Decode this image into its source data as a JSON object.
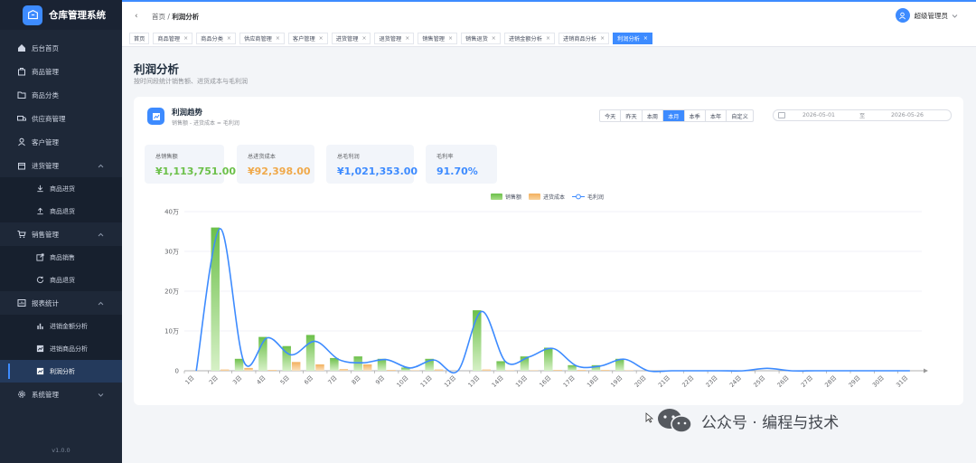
{
  "app": {
    "title": "仓库管理系统",
    "version": "v1.0.0"
  },
  "colors": {
    "accent": "#3d8bff",
    "sales": "#6cc04a",
    "cost": "#f3b05e",
    "profit": "#3d8bff"
  },
  "sidebar": {
    "home": "后台首页",
    "goods": "商品管理",
    "category": "商品分类",
    "supplier": "供应商管理",
    "customer": "客户管理",
    "purchase": "进货管理",
    "purchase_in": "商品进货",
    "purchase_return": "商品退货",
    "sales": "销售管理",
    "sales_out": "商品销售",
    "sales_return": "商品退货",
    "report": "报表统计",
    "report_amount": "进销金额分析",
    "report_goods": "进销商品分析",
    "report_profit": "利润分析",
    "system": "系统管理"
  },
  "header": {
    "breadcrumb_home": "首页",
    "breadcrumb_sep": "/",
    "breadcrumb_current": "利润分析",
    "user": "超级管理员"
  },
  "tabs": [
    {
      "label": "首页",
      "close": ""
    },
    {
      "label": "商品管理",
      "close": "×"
    },
    {
      "label": "商品分类",
      "close": "×"
    },
    {
      "label": "供应商管理",
      "close": "×"
    },
    {
      "label": "客户管理",
      "close": "×"
    },
    {
      "label": "进货管理",
      "close": "×"
    },
    {
      "label": "退货管理",
      "close": "×"
    },
    {
      "label": "销售管理",
      "close": "×"
    },
    {
      "label": "销售退货",
      "close": "×"
    },
    {
      "label": "进销金额分析",
      "close": "×"
    },
    {
      "label": "进销商品分析",
      "close": "×"
    },
    {
      "label": "利润分析",
      "close": "×"
    }
  ],
  "page": {
    "title": "利润分析",
    "subtitle": "按时间段统计销售额、进货成本与毛利润"
  },
  "card": {
    "title": "利润趋势",
    "subtitle": "销售额 - 进货成本 = 毛利润",
    "ranges": [
      "今天",
      "昨天",
      "本周",
      "本月",
      "本季",
      "本年",
      "自定义"
    ],
    "selected_range": "本月",
    "date_start": "2026-05-01",
    "date_sep": "至",
    "date_end": "2026-05-26"
  },
  "stats": {
    "sales_label": "总销售额",
    "sales_value": "¥1,113,751.00",
    "cost_label": "总进货成本",
    "cost_value": "¥92,398.00",
    "profit_label": "总毛利润",
    "profit_value": "¥1,021,353.00",
    "rate_label": "毛利率",
    "rate_value": "91.70%"
  },
  "chart_data": {
    "type": "bar",
    "categories": [
      "1日",
      "2日",
      "3日",
      "4日",
      "5日",
      "6日",
      "7日",
      "8日",
      "9日",
      "10日",
      "11日",
      "12日",
      "13日",
      "14日",
      "15日",
      "16日",
      "17日",
      "18日",
      "19日",
      "20日",
      "21日",
      "22日",
      "23日",
      "24日",
      "25日",
      "26日",
      "27日",
      "28日",
      "29日",
      "30日",
      "31日"
    ],
    "y_ticks": [
      "0",
      "10万",
      "20万",
      "30万",
      "40万"
    ],
    "ylim": [
      0,
      400000
    ],
    "series": [
      {
        "name": "销售额",
        "type": "bar",
        "values": [
          0,
          360000,
          30000,
          85000,
          62000,
          90000,
          32000,
          36000,
          30000,
          8000,
          30000,
          0,
          152000,
          24000,
          36000,
          58000,
          14000,
          14000,
          30000,
          0,
          0,
          0,
          0,
          0,
          0,
          0,
          0,
          0,
          0,
          0,
          0
        ]
      },
      {
        "name": "进货成本",
        "type": "bar",
        "values": [
          0,
          3000,
          7000,
          2000,
          22000,
          16000,
          4000,
          16000,
          2000,
          1000,
          3000,
          0,
          3000,
          1000,
          1000,
          2000,
          2000,
          2000,
          1000,
          0,
          0,
          0,
          0,
          0,
          0,
          0,
          0,
          0,
          0,
          0,
          0
        ]
      },
      {
        "name": "毛利润",
        "type": "line",
        "values": [
          0,
          357000,
          23000,
          83000,
          40000,
          74000,
          28000,
          20000,
          28000,
          7000,
          27000,
          0,
          149000,
          23000,
          35000,
          56000,
          12000,
          12000,
          29000,
          0,
          0,
          0,
          0,
          0,
          6000,
          0,
          0,
          0,
          0,
          0,
          0
        ]
      }
    ],
    "legend_position": "top-center",
    "grid": true
  }
}
